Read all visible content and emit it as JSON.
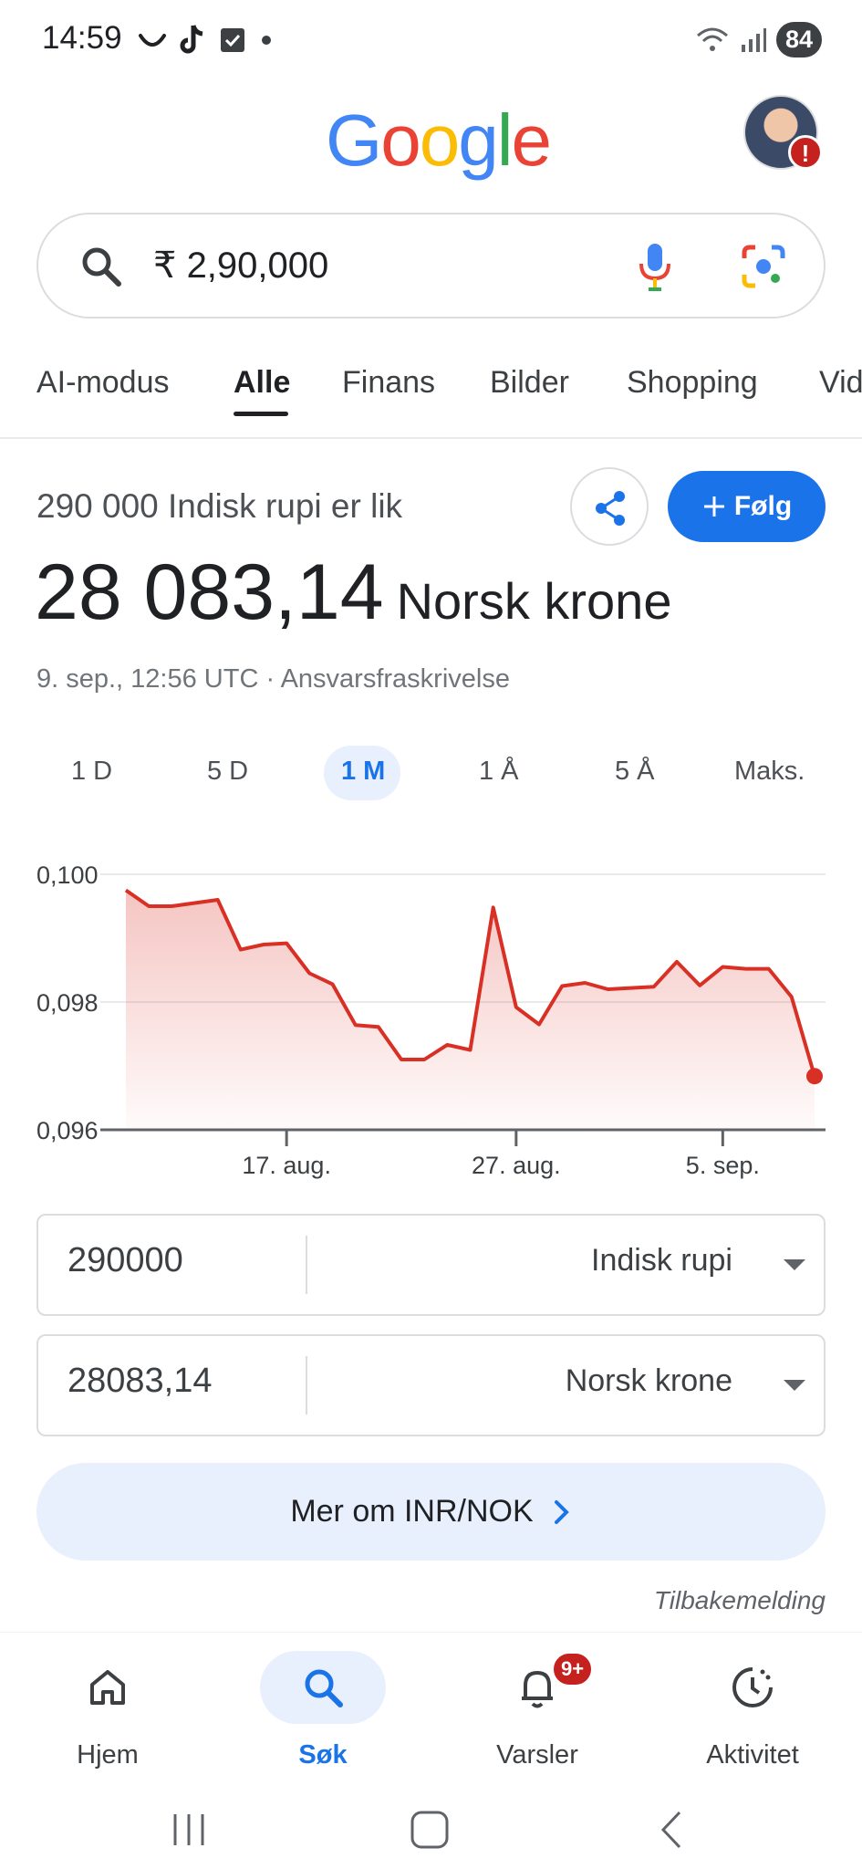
{
  "status_bar": {
    "time": "14:59",
    "battery": "84",
    "icons": [
      "smile-icon",
      "tiktok-icon",
      "checkbox-icon",
      "dot-icon",
      "wifi-icon",
      "signal-icon"
    ]
  },
  "header": {
    "logo_text": "Google"
  },
  "search": {
    "query": "₹ 2,90,000"
  },
  "tabs": [
    {
      "label": "AI-modus"
    },
    {
      "label": "Alle",
      "active": true
    },
    {
      "label": "Finans"
    },
    {
      "label": "Bilder"
    },
    {
      "label": "Shopping"
    },
    {
      "label": "Vid"
    }
  ],
  "result": {
    "label": "290 000 Indisk rupi er lik",
    "value": "28 083,14",
    "unit": "Norsk krone",
    "timestamp": "9. sep., 12:56 UTC",
    "separator": " · ",
    "disclaimer": "Ansvarsfraskrivelse",
    "follow_label": "Følg"
  },
  "ranges": [
    {
      "label": "1 D"
    },
    {
      "label": "5 D"
    },
    {
      "label": "1 M",
      "active": true
    },
    {
      "label": "1 Å"
    },
    {
      "label": "5 Å"
    },
    {
      "label": "Maks."
    }
  ],
  "chart_data": {
    "type": "area",
    "y_ticks": [
      "0,100",
      "0,098",
      "0,096"
    ],
    "ylim": [
      0.096,
      0.1
    ],
    "x_ticks": [
      "17. aug.",
      "27. aug.",
      "5. sep."
    ],
    "x_tick_index": [
      7,
      17,
      26
    ],
    "values": [
      0.09975,
      0.0995,
      0.0995,
      0.09955,
      0.0996,
      0.09882,
      0.0989,
      0.09892,
      0.09845,
      0.09828,
      0.09764,
      0.09761,
      0.0971,
      0.0971,
      0.09733,
      0.09725,
      0.09948,
      0.09792,
      0.09765,
      0.09825,
      0.0983,
      0.0982,
      0.09822,
      0.09824,
      0.09863,
      0.09826,
      0.09855,
      0.09852,
      0.09852,
      0.09808,
      0.09684
    ],
    "color": "#d93025"
  },
  "converter": {
    "from_amount": "290000",
    "from_currency": "Indisk rupi",
    "to_amount": "28083,14",
    "to_currency": "Norsk krone"
  },
  "more_button": "Mer om INR/NOK",
  "feedback": "Tilbakemelding",
  "bottom_nav": [
    {
      "label": "Hjem",
      "icon": "home-icon"
    },
    {
      "label": "Søk",
      "icon": "search-icon",
      "active": true
    },
    {
      "label": "Varsler",
      "icon": "bell-icon",
      "badge": "9+"
    },
    {
      "label": "Aktivitet",
      "icon": "activity-icon"
    }
  ],
  "colors": {
    "accent": "#1a73e8",
    "chart_line": "#d93025",
    "active_bg": "#e8f0fe"
  }
}
